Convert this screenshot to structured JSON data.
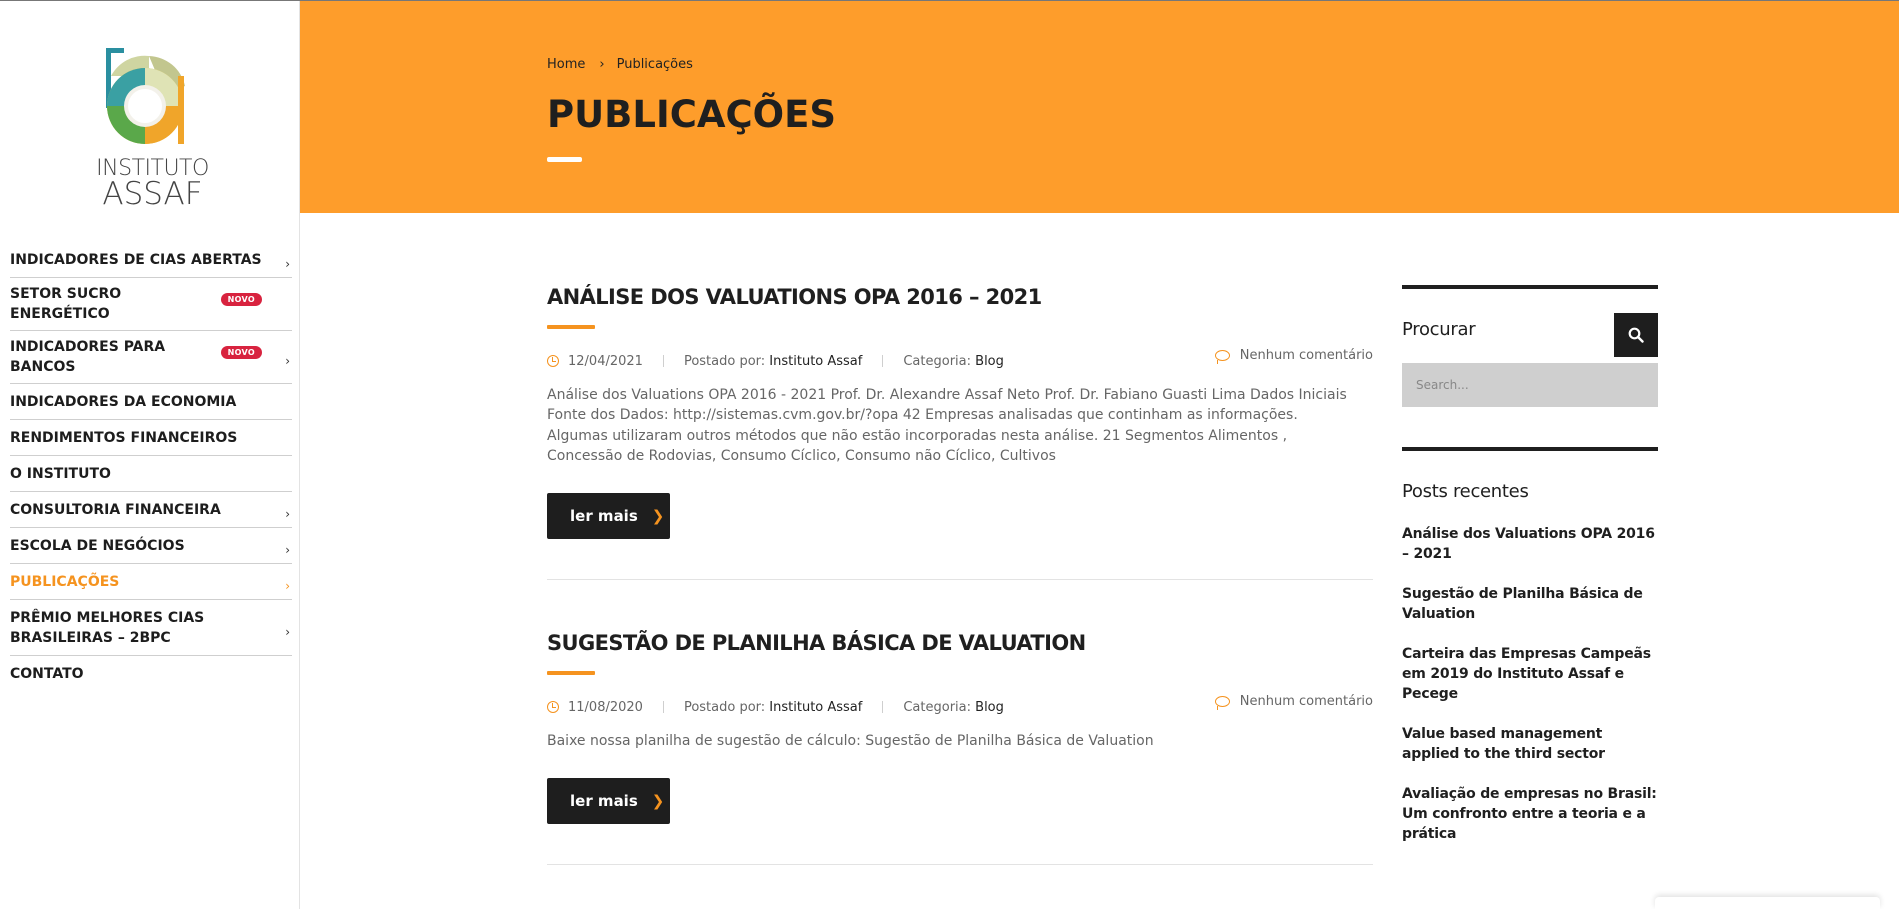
{
  "logo": {
    "line1": "INSTITUTO",
    "line2": "ASSAF"
  },
  "nav": {
    "items": [
      {
        "label": "INDICADORES DE CIAS ABERTAS",
        "chevron": true,
        "badge": ""
      },
      {
        "label": "SETOR SUCRO ENERGÉTICO",
        "chevron": false,
        "badge": "NOVO"
      },
      {
        "label": "INDICADORES PARA BANCOS",
        "chevron": true,
        "badge": "NOVO"
      },
      {
        "label": "INDICADORES DA ECONOMIA",
        "chevron": false,
        "badge": ""
      },
      {
        "label": "RENDIMENTOS FINANCEIROS",
        "chevron": false,
        "badge": ""
      },
      {
        "label": "O INSTITUTO",
        "chevron": false,
        "badge": ""
      },
      {
        "label": "CONSULTORIA FINANCEIRA",
        "chevron": true,
        "badge": ""
      },
      {
        "label": "ESCOLA DE NEGÓCIOS",
        "chevron": true,
        "badge": ""
      },
      {
        "label": "PUBLICAÇÕES",
        "chevron": true,
        "badge": "",
        "active": true
      },
      {
        "label": "PRÊMIO MELHORES CIAS BRASILEIRAS – 2BPC",
        "chevron": true,
        "badge": ""
      },
      {
        "label": "CONTATO",
        "chevron": false,
        "badge": ""
      }
    ]
  },
  "breadcrumb": {
    "home": "Home",
    "sep": "›",
    "current": "Publicações"
  },
  "page_title": "PUBLICAÇÕES",
  "posts": [
    {
      "title": "ANÁLISE DOS VALUATIONS OPA 2016 – 2021",
      "date": "12/04/2021",
      "posted_by_label": "Postado por:",
      "author": "Instituto Assaf",
      "category_label": "Categoria:",
      "category": "Blog",
      "comments": "Nenhum comentário",
      "excerpt": "Análise dos Valuations OPA 2016 - 2021   Prof. Dr. Alexandre Assaf Neto Prof. Dr. Fabiano Guasti Lima   Dados Iniciais Fonte dos Dados: http://sistemas.cvm.gov.br/?opa 42 Empresas analisadas que continham as informações. Algumas utilizaram outros métodos que não estão incorporadas nesta análise. 21 Segmentos Alimentos , Concessão de Rodovias, Consumo Cíclico, Consumo não Cíclico, Cultivos",
      "button": "ler mais"
    },
    {
      "title": "SUGESTÃO DE PLANILHA BÁSICA DE VALUATION",
      "date": "11/08/2020",
      "posted_by_label": "Postado por:",
      "author": "Instituto Assaf",
      "category_label": "Categoria:",
      "category": "Blog",
      "comments": "Nenhum comentário",
      "excerpt": "Baixe nossa planilha de sugestão de cálculo: Sugestão de Planilha Básica de Valuation",
      "button": "ler mais"
    }
  ],
  "search_widget": {
    "title": "Procurar",
    "placeholder": "Search..."
  },
  "recent_widget": {
    "title": "Posts recentes",
    "items": [
      "Análise dos Valuations OPA 2016 – 2021",
      "Sugestão de Planilha Básica de Valuation",
      "Carteira das Empresas Campeãs em 2019 do Instituto Assaf e Pecege",
      "Value based management applied to the third sector",
      "Avaliação de empresas no Brasil: Um confronto entre a teoria e a prática"
    ]
  },
  "colors": {
    "accent": "#f5931f",
    "hero": "#fe9d2b",
    "dark": "#1e1e1e",
    "badge": "#d8233f"
  },
  "icons": {
    "nav_chevron": "chevron-right-icon",
    "clock": "clock-icon",
    "comment": "comment-icon",
    "search": "search-icon",
    "button_arrow": "chevron-right-icon"
  }
}
